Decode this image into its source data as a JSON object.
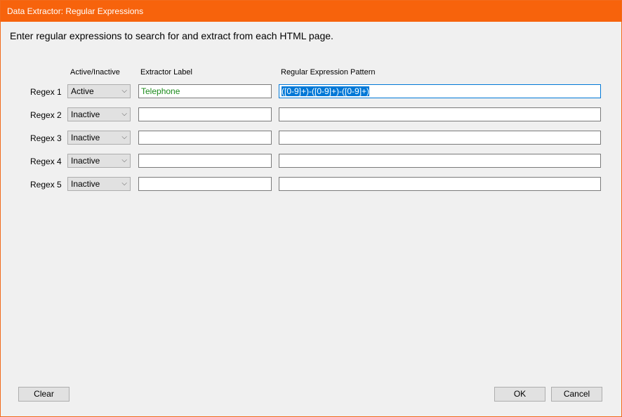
{
  "window": {
    "title": "Data Extractor: Regular Expressions"
  },
  "instruction": "Enter regular expressions to search for and extract from each HTML page.",
  "columns": {
    "status": "Active/Inactive",
    "label": "Extractor Label",
    "pattern": "Regular Expression Pattern"
  },
  "rows": [
    {
      "name": "Regex 1",
      "status": "Active",
      "label": "Telephone",
      "pattern": "([0-9]+)-([0-9]+)-([0-9]+)"
    },
    {
      "name": "Regex 2",
      "status": "Inactive",
      "label": "",
      "pattern": ""
    },
    {
      "name": "Regex 3",
      "status": "Inactive",
      "label": "",
      "pattern": ""
    },
    {
      "name": "Regex 4",
      "status": "Inactive",
      "label": "",
      "pattern": ""
    },
    {
      "name": "Regex 5",
      "status": "Inactive",
      "label": "",
      "pattern": ""
    }
  ],
  "buttons": {
    "clear": "Clear",
    "ok": "OK",
    "cancel": "Cancel"
  },
  "icons": {
    "dropdown": "⌵"
  },
  "colors": {
    "titlebar": "#f7630c",
    "label_text": "#1a8a1a",
    "selection": "#0078d7"
  }
}
